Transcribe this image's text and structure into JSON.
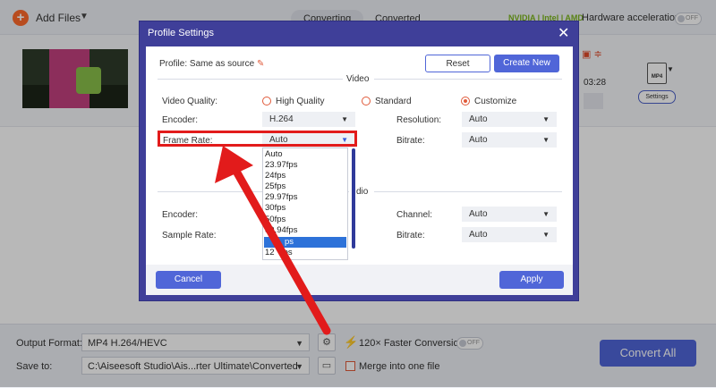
{
  "topbar": {
    "add_files": "Add Files",
    "tabs": [
      "Converting",
      "Converted"
    ],
    "hw_brands": "NVIDIA | Intel | AMD",
    "hw_label": "Hardware acceleration",
    "hw_toggle": "OFF"
  },
  "file": {
    "time_partial": "03:28",
    "settings_label": "Settings",
    "format_icon": "MP4"
  },
  "bottom": {
    "output_format_label": "Output Format:",
    "output_format_value": "MP4 H.264/HEVC",
    "save_to_label": "Save to:",
    "save_to_value": "C:\\Aiseesoft Studio\\Ais...rter Ultimate\\Converted",
    "faster_label": "120× Faster Conversion",
    "faster_toggle": "OFF",
    "merge_label": "Merge into one file",
    "convert_all": "Convert All"
  },
  "dialog": {
    "title": "Profile Settings",
    "profile_label": "Profile:",
    "profile_value": "Same as source",
    "reset": "Reset",
    "create_new": "Create New",
    "video_section": "Video",
    "audio_section_partial": "dio",
    "video_quality_label": "Video Quality:",
    "quality_options": [
      "High Quality",
      "Standard",
      "Customize"
    ],
    "quality_selected": "Customize",
    "encoder_label": "Encoder:",
    "encoder_value": "H.264",
    "resolution_label": "Resolution:",
    "resolution_value": "Auto",
    "frame_rate_label": "Frame Rate:",
    "frame_rate_value": "Auto",
    "bitrate_label": "Bitrate:",
    "bitrate_value": "Auto",
    "audio_encoder_label": "Encoder:",
    "sample_rate_label": "Sample Rate:",
    "channel_label": "Channel:",
    "channel_value": "Auto",
    "audio_bitrate_label": "Bitrate:",
    "audio_bitrate_value": "Auto",
    "frame_rate_options": [
      "Auto",
      "23.97fps",
      "24fps",
      "25fps",
      "29.97fps",
      "30fps",
      "50fps",
      "59.94fps",
      "60fps",
      "120fps"
    ],
    "frame_rate_highlighted_visible": "ps",
    "frame_rate_partial_last": "12",
    "frame_rate_partial_last_tail": "ps",
    "cancel": "Cancel",
    "apply": "Apply"
  },
  "colors": {
    "accent": "#5066d8",
    "dialog_frame": "#3f3f99",
    "highlight_red": "#e21b1b",
    "brand_orange": "#ff6a2b"
  }
}
